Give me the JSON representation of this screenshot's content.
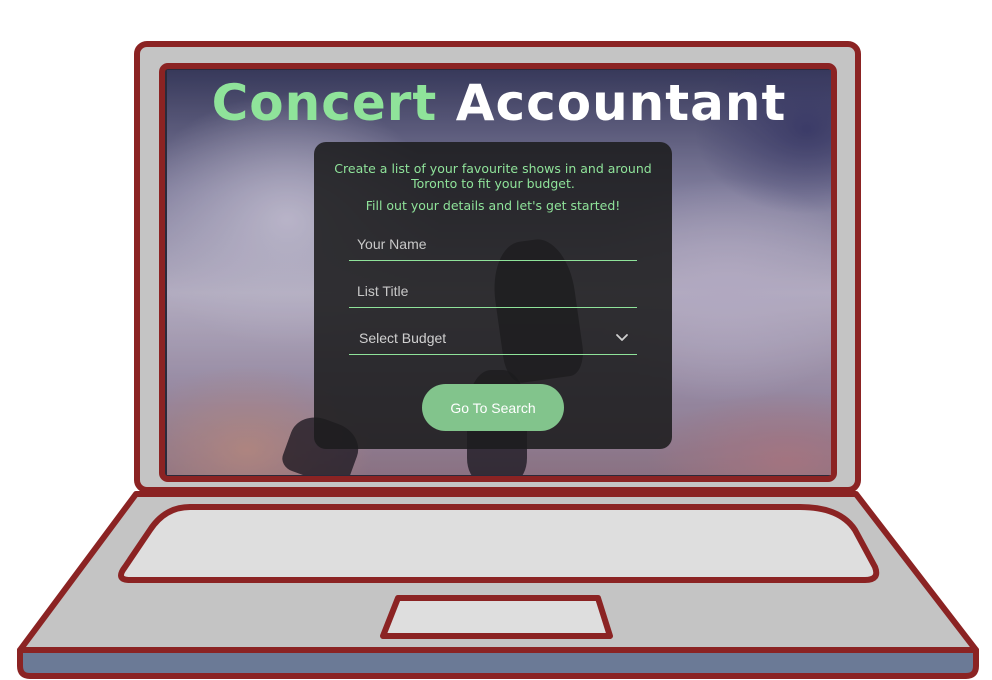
{
  "app": {
    "title_part1": "Concert",
    "title_part2": "Accountant"
  },
  "form": {
    "intro_line1": "Create a list of your favourite shows in and around Toronto to fit your budget.",
    "intro_line2": "Fill out your details and let's get started!",
    "name_placeholder": "Your Name",
    "list_title_placeholder": "List Title",
    "budget_selected": "Select Budget",
    "submit_label": "Go To Search"
  },
  "icons": {
    "dropdown": "chevron-down-icon"
  },
  "colors": {
    "accent": "#8fe39a",
    "button": "#82c48c",
    "laptop_outline": "#8b2323",
    "laptop_body": "#c4c4c4",
    "laptop_base_strip": "#6b7a96"
  }
}
